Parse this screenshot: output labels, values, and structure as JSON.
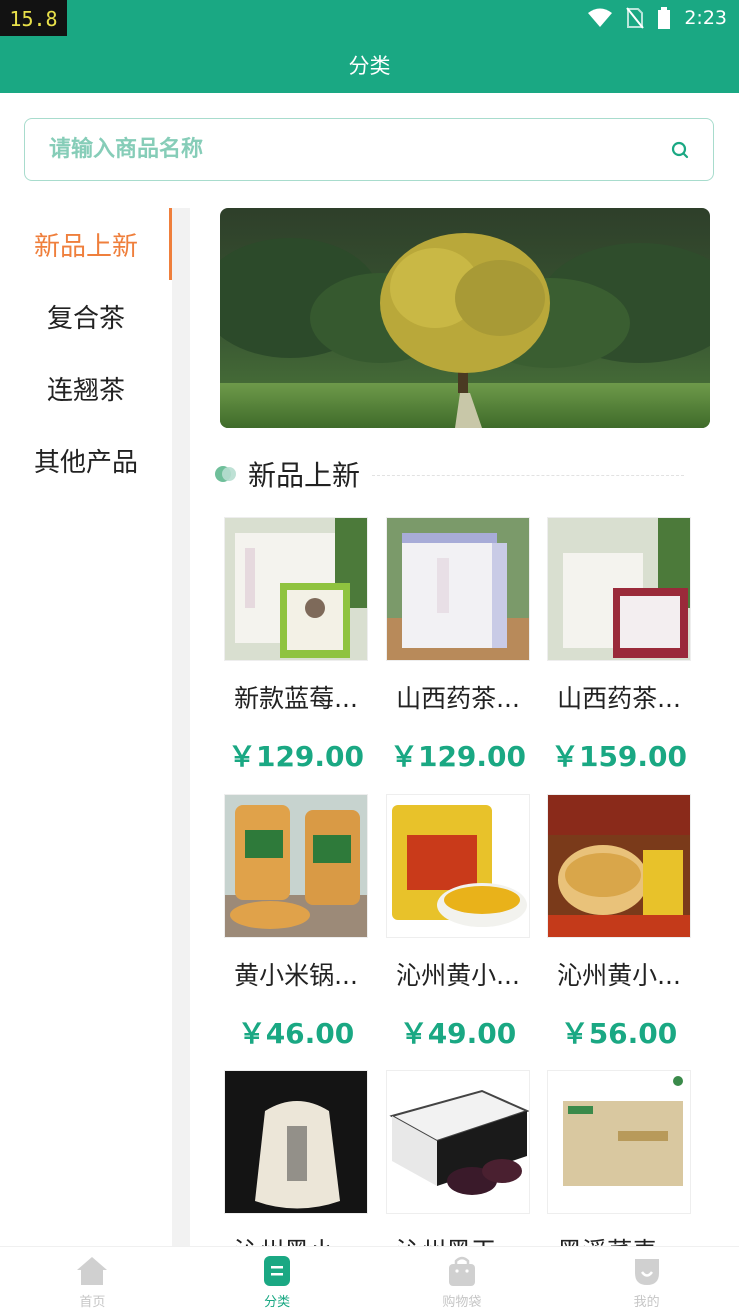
{
  "status_bar": {
    "fps": "15.8",
    "time": "2:23"
  },
  "app_bar": {
    "title": "分类"
  },
  "search": {
    "placeholder": "请输入商品名称"
  },
  "sidebar": {
    "items": [
      {
        "label": "新品上新",
        "active": true
      },
      {
        "label": "复合茶",
        "active": false
      },
      {
        "label": "连翘茶",
        "active": false
      },
      {
        "label": "其他产品",
        "active": false
      }
    ]
  },
  "section": {
    "title": "新品上新"
  },
  "products": [
    {
      "name": "新款蓝莓...",
      "price": "￥129.00"
    },
    {
      "name": "山西药茶...",
      "price": "￥129.00"
    },
    {
      "name": "山西药茶...",
      "price": "￥159.00"
    },
    {
      "name": "黄小米锅...",
      "price": "￥46.00"
    },
    {
      "name": "沁州黄小...",
      "price": "￥49.00"
    },
    {
      "name": "沁州黄小...",
      "price": "￥56.00"
    },
    {
      "name": "沁州黑小...",
      "price": ""
    },
    {
      "name": "沁州黑玉...",
      "price": ""
    },
    {
      "name": "黑溪荞麦...",
      "price": ""
    }
  ],
  "tabbar": {
    "items": [
      {
        "label": "首页",
        "icon": "home-icon"
      },
      {
        "label": "分类",
        "icon": "category-icon"
      },
      {
        "label": "购物袋",
        "icon": "shopping-bag-icon"
      },
      {
        "label": "我的",
        "icon": "profile-icon"
      }
    ]
  },
  "colors": {
    "brand": "#1aa883",
    "active": "#ef7f3c"
  }
}
